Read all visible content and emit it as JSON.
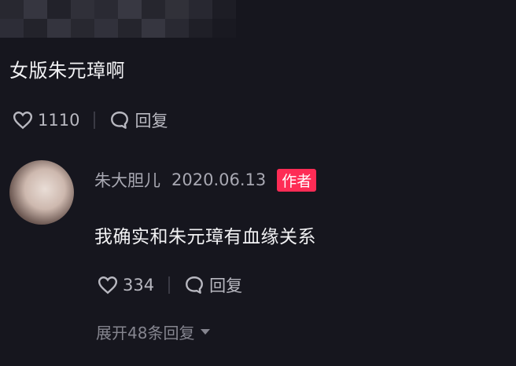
{
  "comment": {
    "text": "女版朱元璋啊",
    "likes": "1110",
    "reply_label": "回复"
  },
  "reply": {
    "author": "朱大胆儿",
    "date": "2020.06.13",
    "badge": "作者",
    "text": "我确实和朱元璋有血缘关系",
    "likes": "334",
    "reply_label": "回复"
  },
  "expand": {
    "label": "展开48条回复"
  },
  "colors": {
    "background": "#16161e",
    "badge": "#fe2c55",
    "muted": "#a8a8b2"
  }
}
